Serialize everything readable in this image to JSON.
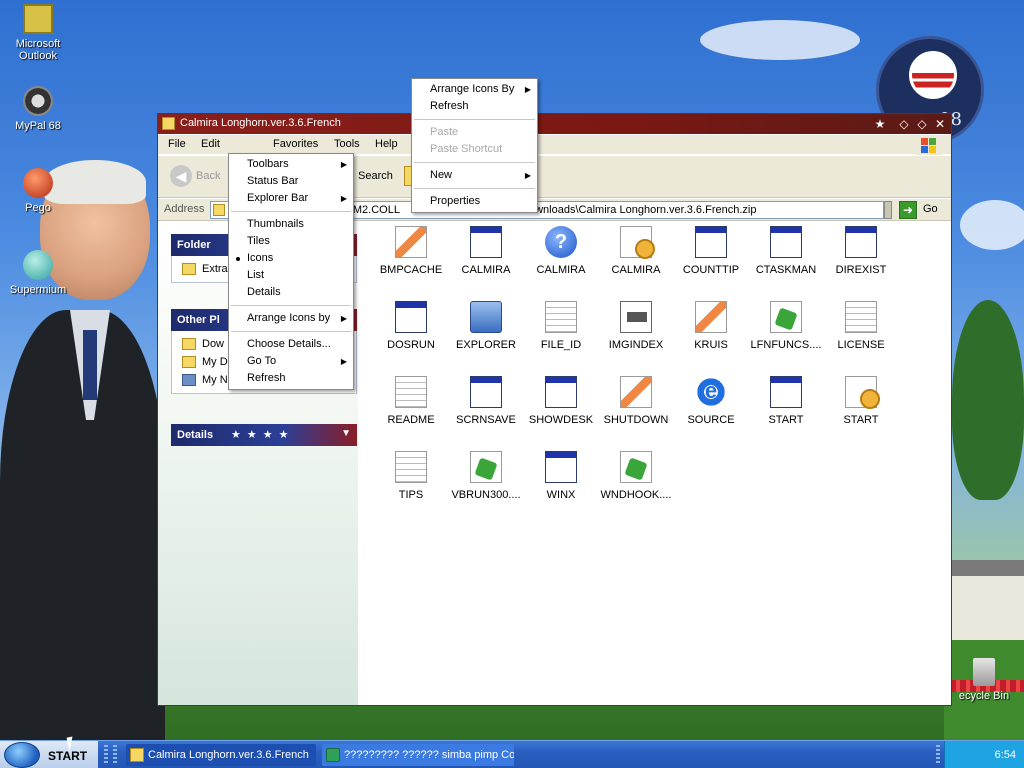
{
  "desktop": {
    "icons": [
      {
        "label": "Microsoft Outlook",
        "icon": "outlook-icon"
      },
      {
        "label": "MyPal 68",
        "icon": "raccoon-icon"
      },
      {
        "label": "Pego",
        "icon": "pego-icon"
      },
      {
        "label": "Supermium",
        "icon": "supermium-icon"
      }
    ],
    "recycle_bin": "ecycle Bin",
    "badge_year": "08"
  },
  "window": {
    "title": "Calmira Longhorn.ver.3.6.French",
    "menu": [
      "File",
      "Edit",
      "View",
      "Favorites",
      "Tools",
      "Help"
    ],
    "toolbar": {
      "back": "Back",
      "search": "Search"
    },
    "address": {
      "label": "Address",
      "value": "s\\VM2.COLL",
      "value_tail": "ownloads\\Calmira Longhorn.ver.3.6.French.zip",
      "go": "Go"
    },
    "panels": [
      {
        "title": "Folder",
        "rows": [
          "Extra"
        ]
      },
      {
        "title": "Other Pl",
        "rows": [
          "Dow",
          "My D",
          "My N"
        ]
      },
      {
        "title": "Details",
        "rows": []
      }
    ],
    "files": [
      {
        "name": "BMPCACHE",
        "icon": "brush"
      },
      {
        "name": "CALMIRA",
        "icon": "app"
      },
      {
        "name": "CALMIRA",
        "icon": "help"
      },
      {
        "name": "CALMIRA",
        "icon": "gear"
      },
      {
        "name": "COUNTTIP",
        "icon": "app"
      },
      {
        "name": "CTASKMAN",
        "icon": "app"
      },
      {
        "name": "DIREXIST",
        "icon": "app"
      },
      {
        "name": "DOSRUN",
        "icon": "app"
      },
      {
        "name": "EXPLORER",
        "icon": "pc"
      },
      {
        "name": "FILE_ID",
        "icon": "doc"
      },
      {
        "name": "IMGINDEX",
        "icon": "img"
      },
      {
        "name": "KRUIS",
        "icon": "brush"
      },
      {
        "name": "LFNFUNCS....",
        "icon": "green"
      },
      {
        "name": "LICENSE",
        "icon": "doc"
      },
      {
        "name": "README",
        "icon": "doc"
      },
      {
        "name": "SCRNSAVE",
        "icon": "app"
      },
      {
        "name": "SHOWDESK",
        "icon": "app"
      },
      {
        "name": "SHUTDOWN",
        "icon": "brush"
      },
      {
        "name": "SOURCE",
        "icon": "ie"
      },
      {
        "name": "START",
        "icon": "app"
      },
      {
        "name": "START",
        "icon": "gear"
      },
      {
        "name": "TIPS",
        "icon": "doc"
      },
      {
        "name": "VBRUN300....",
        "icon": "green"
      },
      {
        "name": "WINX",
        "icon": "app"
      },
      {
        "name": "WNDHOOK....",
        "icon": "green"
      }
    ]
  },
  "view_menu": {
    "items": [
      {
        "label": "Toolbars",
        "submenu": true
      },
      {
        "label": "Status Bar"
      },
      {
        "label": "Explorer Bar",
        "submenu": true
      },
      {
        "sep": true
      },
      {
        "label": "Thumbnails"
      },
      {
        "label": "Tiles"
      },
      {
        "label": "Icons",
        "selected": true
      },
      {
        "label": "List"
      },
      {
        "label": "Details"
      },
      {
        "sep": true
      },
      {
        "label": "Arrange Icons by",
        "submenu": true
      },
      {
        "sep": true
      },
      {
        "label": "Choose Details..."
      },
      {
        "label": "Go To",
        "submenu": true
      },
      {
        "label": "Refresh"
      }
    ]
  },
  "context_menu": {
    "items": [
      {
        "label": "Arrange Icons By",
        "submenu": true
      },
      {
        "label": "Refresh"
      },
      {
        "sep": true
      },
      {
        "label": "Paste",
        "disabled": true
      },
      {
        "label": "Paste Shortcut",
        "disabled": true
      },
      {
        "sep": true
      },
      {
        "label": "New",
        "submenu": true
      },
      {
        "sep": true
      },
      {
        "label": "Properties"
      }
    ]
  },
  "taskbar": {
    "start": "START",
    "tasks": [
      {
        "label": "Calmira Longhorn.ver.3.6.French"
      },
      {
        "label": "????????? ?????? simba pimp Con..."
      }
    ],
    "clock": "6:54"
  },
  "colors": {
    "title_bar": "#7a1814",
    "panel_header": "#1d2a6b",
    "taskbar": "#2a5fc0"
  }
}
